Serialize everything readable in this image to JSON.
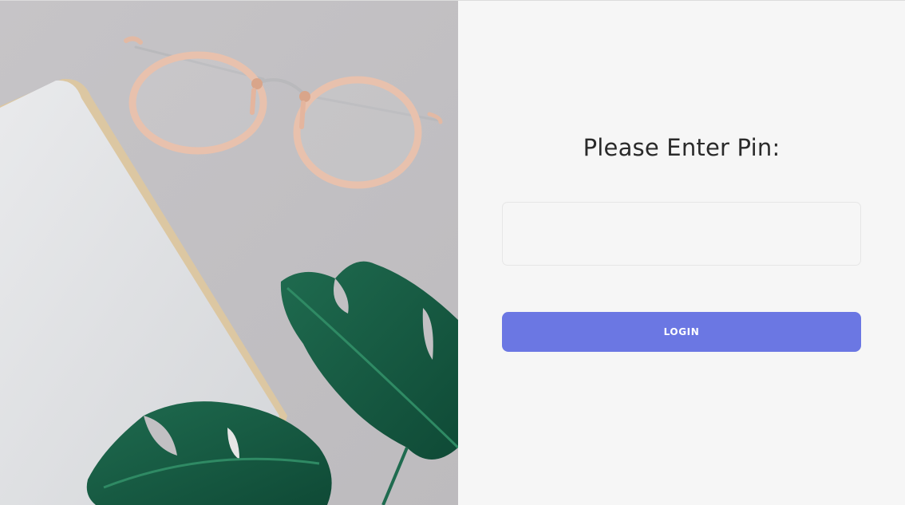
{
  "login": {
    "title": "Please Enter Pin:",
    "pin_placeholder": "",
    "pin_value": "",
    "button_label": "LOGIN",
    "button_color": "#6b77e3"
  },
  "photo": {
    "depicts": [
      "glasses",
      "notebook",
      "monstera-leaf"
    ],
    "background_color": "#c2c0c3"
  }
}
